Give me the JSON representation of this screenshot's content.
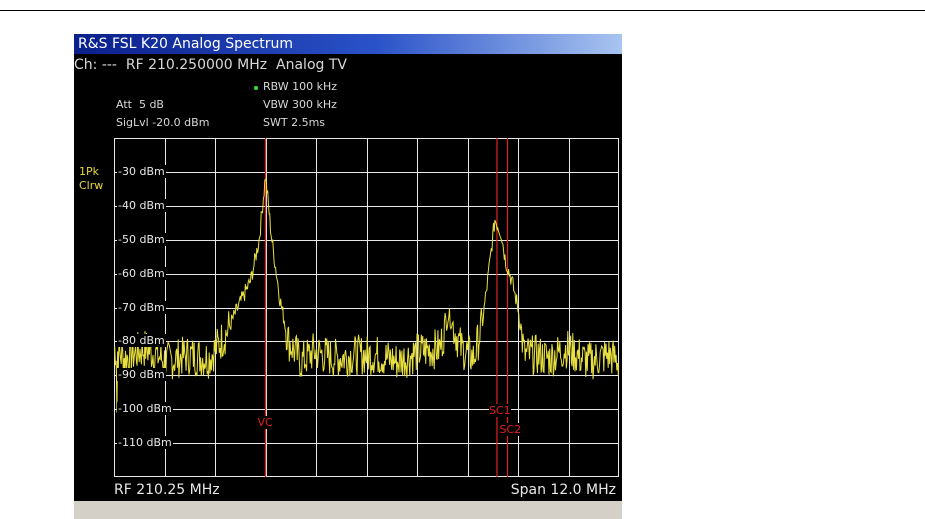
{
  "window": {
    "title": "R&S FSL K20 Analog Spectrum",
    "channel_line": "Ch: ---  RF 210.250000 MHz  Analog TV"
  },
  "settings": {
    "att": "Att  5 dB",
    "siglvl": "SigLvl -20.0 dBm",
    "rbw": "RBW 100 kHz",
    "vbw": "VBW 300 kHz",
    "swt": "SWT 2.5ms"
  },
  "trace": {
    "label_line1": "1Pk",
    "label_line2": "Clrw",
    "color": "#e8e040"
  },
  "markers": {
    "vc": "VC",
    "sc1": "SC1",
    "sc2": "SC2",
    "color": "#e02020"
  },
  "footer": {
    "center": "RF 210.25 MHz",
    "span": "Span 12.0 MHz"
  },
  "chart_data": {
    "type": "line",
    "center_freq_mhz": 210.25,
    "span_mhz": 12.0,
    "ylim": [
      -120,
      -20
    ],
    "y_ticks": [
      "-30 dBm",
      "-40 dBm",
      "-50 dBm",
      "-60 dBm",
      "-70 dBm",
      "-80 dBm",
      "-90 dBm",
      "-100 dBm",
      "-110 dBm"
    ],
    "grid": true,
    "marker_positions_mhz": {
      "VC": 207.85,
      "SC1": 213.35,
      "SC2": 213.6
    },
    "series": [
      {
        "x": [
          204.25,
          204.5,
          205.0,
          205.5,
          206.0,
          206.5,
          206.9,
          207.2,
          207.5,
          207.7,
          207.85,
          208.0,
          208.2,
          208.4,
          208.7,
          209.0,
          209.5,
          210.0,
          210.5,
          211.0,
          211.5,
          212.0,
          212.2,
          212.5,
          212.8,
          213.0,
          213.15,
          213.3,
          213.45,
          213.55,
          213.7,
          213.85,
          214.0,
          214.3,
          214.6,
          215.0,
          215.5,
          216.0,
          216.25
        ],
        "values": [
          -82,
          -85,
          -82,
          -86,
          -84,
          -85,
          -78,
          -70,
          -62,
          -50,
          -31,
          -50,
          -68,
          -80,
          -86,
          -83,
          -85,
          -84,
          -84,
          -86,
          -83,
          -82,
          -72,
          -82,
          -85,
          -75,
          -60,
          -44,
          -48,
          -56,
          -62,
          -70,
          -84,
          -84,
          -85,
          -82,
          -86,
          -84,
          -86
        ]
      }
    ]
  }
}
